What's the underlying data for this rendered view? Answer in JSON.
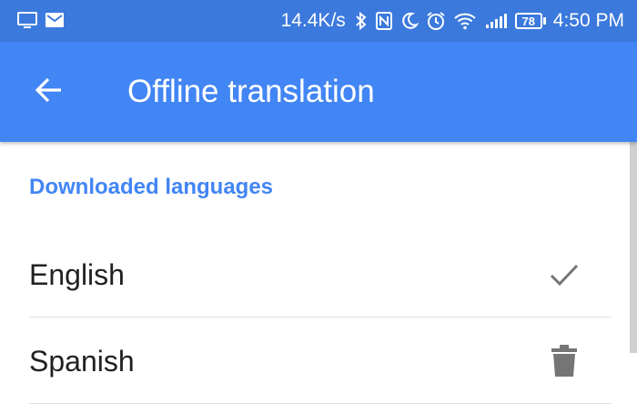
{
  "status_bar": {
    "network_speed": "14.4K/s",
    "battery_level": "78",
    "time": "4:50 PM",
    "icons": [
      "screen-icon",
      "gmail-icon",
      "bluetooth-icon",
      "nfc-icon",
      "do-not-disturb-icon",
      "alarm-icon",
      "wifi-icon",
      "signal-icon",
      "battery-icon"
    ]
  },
  "app_bar": {
    "title": "Offline translation",
    "back_icon": "back-arrow-icon"
  },
  "section": {
    "header": "Downloaded languages"
  },
  "languages": [
    {
      "label": "English",
      "action_icon": "checkmark-icon"
    },
    {
      "label": "Spanish",
      "action_icon": "delete-icon"
    }
  ],
  "colors": {
    "status_bar": "#3b79dc",
    "app_bar": "#4285f4",
    "accent": "#4285f4",
    "icon_gray": "#757575"
  }
}
